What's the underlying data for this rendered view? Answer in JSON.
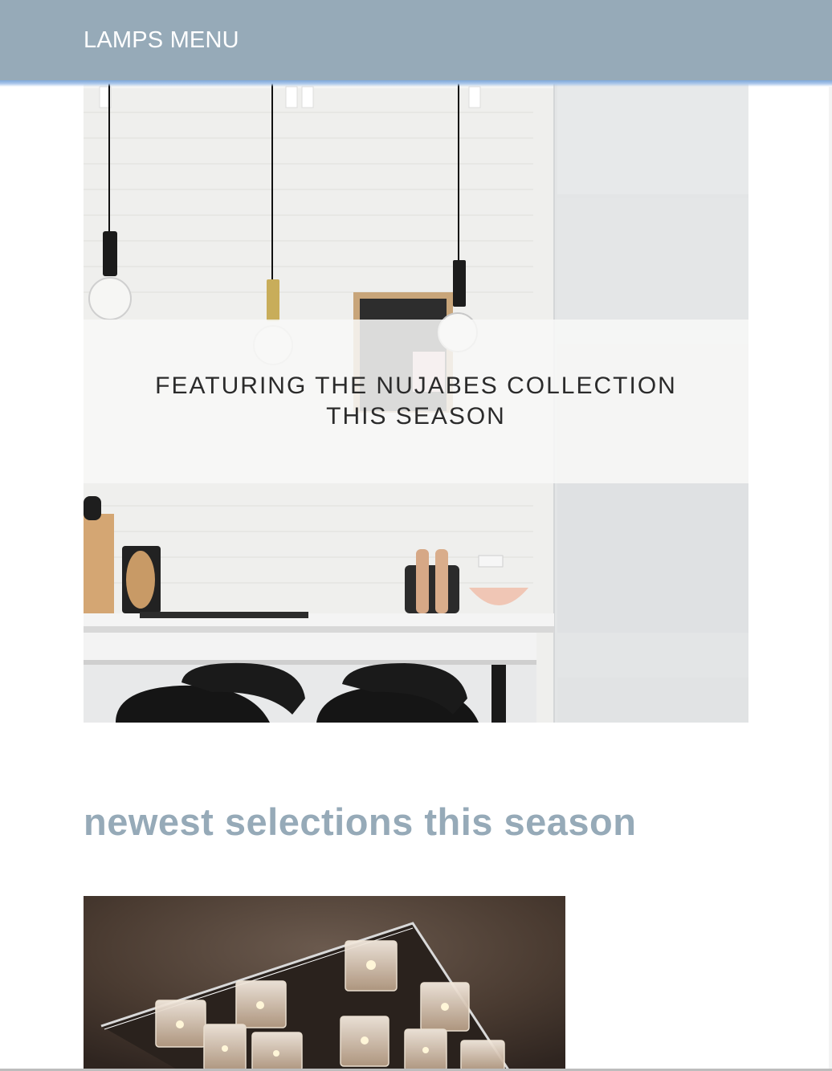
{
  "header": {
    "menu_label": "LAMPS MENU",
    "background_color": "#96aab8"
  },
  "hero": {
    "image_description_icon": "kitchen-pendant-lamps-image",
    "banner_line_1": "FEATURING THE NUJABES COLLECTION",
    "banner_line_2": "THIS SEASON"
  },
  "section": {
    "title": "newest selections this season",
    "title_color": "#96aab8"
  },
  "products": [
    {
      "image_icon": "crystal-ceiling-lamp-image"
    }
  ]
}
